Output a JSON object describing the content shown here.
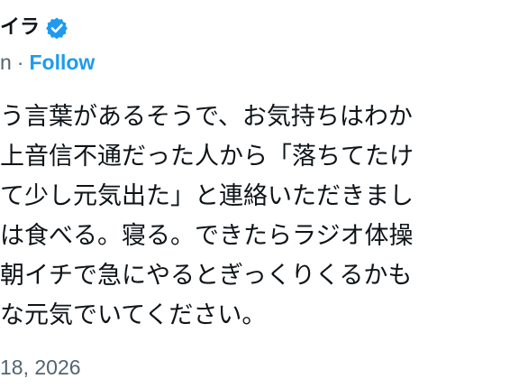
{
  "header": {
    "author_name": "イラ",
    "verified_icon": "verified-badge-icon",
    "handle": "n",
    "separator": "·",
    "follow_label": "Follow"
  },
  "post": {
    "lines": [
      "う言葉があるそうで、お気持ちはわか",
      "上音信不通だった人から「落ちてたけ",
      "て少し元気出た」と連絡いただきまし",
      "は食べる。寝る。できたらラジオ体操",
      "朝イチで急にやるとぎっくりくるかも",
      "な元気でいてください。"
    ],
    "date": "18, 2026"
  },
  "colors": {
    "text": "#0f1419",
    "secondary": "#536471",
    "accent": "#1d9bf0"
  }
}
